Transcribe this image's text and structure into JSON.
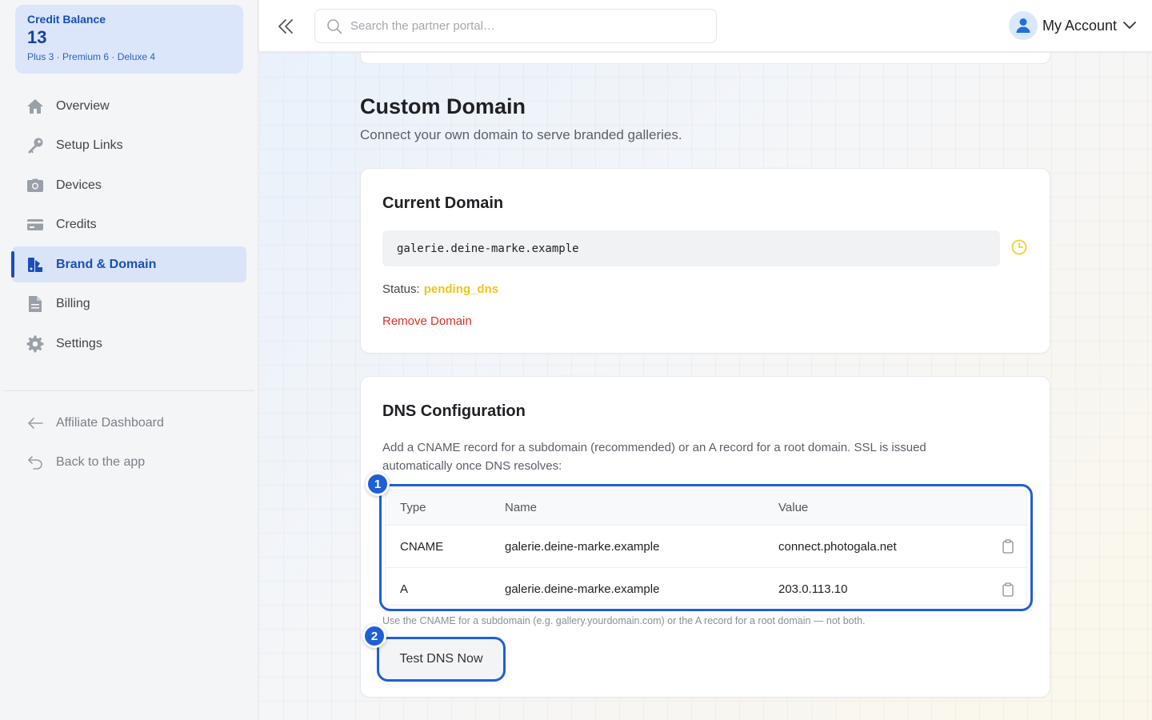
{
  "sidebar": {
    "credits": {
      "title": "Credit Balance",
      "value": "13",
      "breakdown": "Plus 3 · Premium 6 · Deluxe 4"
    },
    "items": [
      {
        "label": "Overview",
        "icon": "home-icon"
      },
      {
        "label": "Setup Links",
        "icon": "key-icon"
      },
      {
        "label": "Devices",
        "icon": "camera-icon"
      },
      {
        "label": "Credits",
        "icon": "credit-card-icon"
      },
      {
        "label": "Brand & Domain",
        "icon": "brand-icon",
        "active": true
      },
      {
        "label": "Billing",
        "icon": "document-icon"
      },
      {
        "label": "Settings",
        "icon": "gear-icon"
      }
    ],
    "secondary": [
      {
        "label": "Affiliate Dashboard",
        "icon": "arrow-left-icon"
      },
      {
        "label": "Back to the app",
        "icon": "return-icon"
      }
    ]
  },
  "topbar": {
    "search_placeholder": "Search the partner portal…",
    "account_label": "My Account"
  },
  "page": {
    "title": "Custom Domain",
    "subtitle": "Connect your own domain to serve branded galleries."
  },
  "current_domain": {
    "title": "Current Domain",
    "domain": "galerie.deine-marke.example",
    "status_label": "Status:",
    "status_value": "pending_dns",
    "remove_label": "Remove Domain"
  },
  "dns": {
    "title": "DNS Configuration",
    "description": "Add a CNAME record for a subdomain (recommended) or an A record for a root domain. SSL is issued automatically once DNS resolves:",
    "headers": [
      "Type",
      "Name",
      "Value"
    ],
    "rows": [
      {
        "type": "CNAME",
        "name": "galerie.deine-marke.example",
        "value": "connect.photogala.net"
      },
      {
        "type": "A",
        "name": "galerie.deine-marke.example",
        "value": "203.0.113.10"
      }
    ],
    "note": "Use the CNAME for a subdomain (e.g. gallery.yourdomain.com) or the A record for a root domain — not both.",
    "test_button": "Test DNS Now"
  },
  "badges": [
    "1",
    "2"
  ],
  "colors": {
    "accent": "#1f5fd6",
    "status_pending": "#eec51a",
    "danger": "#d93025"
  }
}
